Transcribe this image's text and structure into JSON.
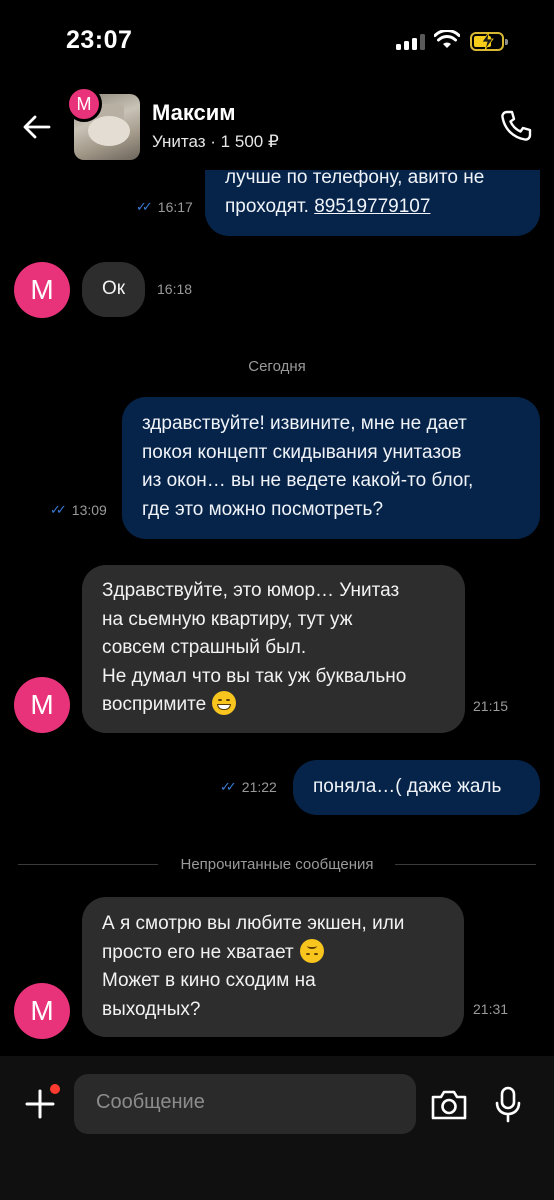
{
  "status": {
    "time": "23:07"
  },
  "header": {
    "avatar_letter": "M",
    "contact_name": "Максим",
    "listing": "Унитаз · 1 500 ₽"
  },
  "messages": [
    {
      "from": "me",
      "lines": [
        "лучше по телефону, авито не",
        "проходят. "
      ],
      "link": "89519779107",
      "time": "16:17",
      "read": true
    },
    {
      "from": "contact",
      "lines": [
        "Ок"
      ],
      "time": "16:18"
    },
    {
      "from": "me",
      "lines": [
        "здравствуйте! извините, мне не дает",
        "покоя концепт скидывания унитазов",
        "из окон… вы не ведете какой-то блог,",
        "где это можно посмотреть?"
      ],
      "time": "13:09",
      "read": true
    },
    {
      "from": "contact",
      "lines": [
        "Здравствуйте, это юмор… Унитаз",
        "на сьемную квартиру, тут уж",
        "совсем страшный был.",
        "Не думал что вы так уж буквально",
        "воспримите"
      ],
      "emoji": "grinning-face",
      "time": "21:15"
    },
    {
      "from": "me",
      "lines": [
        "поняла…( даже жаль"
      ],
      "time": "21:22",
      "read": true
    },
    {
      "from": "contact",
      "lines": [
        "А я смотрю вы любите экшен, или",
        "просто его не хватает",
        "Может в кино сходим на",
        "выходных?"
      ],
      "emoji": "upside-down-face",
      "time": "21:31"
    }
  ],
  "dividers": {
    "today": "Сегодня",
    "unread": "Непрочитанные сообщения"
  },
  "composer": {
    "placeholder": "Сообщение"
  },
  "colors": {
    "outgoing_bubble": "#06244a",
    "incoming_bubble": "#2d2d2d",
    "avatar": "#e8337a",
    "read_ticks": "#3a7bd5",
    "notification_dot": "#ff3b30"
  },
  "icons": [
    "back-arrow-icon",
    "phone-icon",
    "plus-icon",
    "camera-icon",
    "microphone-icon",
    "signal-icon",
    "wifi-icon",
    "battery-icon",
    "double-check-icon"
  ]
}
